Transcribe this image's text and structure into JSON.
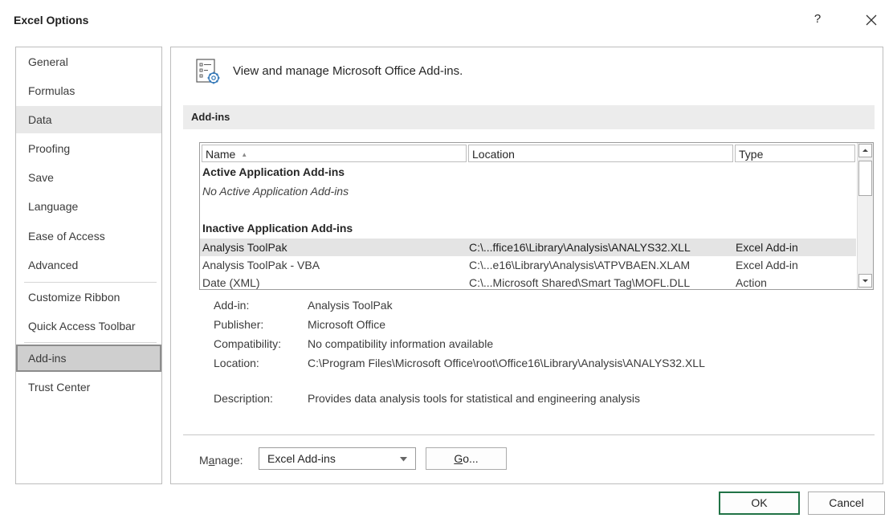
{
  "window": {
    "title": "Excel Options",
    "help_label": "?",
    "close_icon": "close-icon"
  },
  "sidebar": {
    "items": [
      {
        "label": "General"
      },
      {
        "label": "Formulas"
      },
      {
        "label": "Data"
      },
      {
        "label": "Proofing"
      },
      {
        "label": "Save"
      },
      {
        "label": "Language"
      },
      {
        "label": "Ease of Access"
      },
      {
        "label": "Advanced"
      },
      {
        "label": "Customize Ribbon"
      },
      {
        "label": "Quick Access Toolbar"
      },
      {
        "label": "Add-ins"
      },
      {
        "label": "Trust Center"
      }
    ],
    "selected": "Add-ins",
    "hovered": "Data"
  },
  "header": {
    "icon": "addins-gear-icon",
    "text": "View and manage Microsoft Office Add-ins."
  },
  "section": {
    "title": "Add-ins"
  },
  "addins_list": {
    "columns": [
      "Name",
      "Location",
      "Type"
    ],
    "sort_indicator": "▲",
    "groups": [
      {
        "header": "Active Application Add-ins",
        "empty_text": "No Active Application Add-ins"
      },
      {
        "header": "Inactive Application Add-ins"
      }
    ],
    "rows": [
      {
        "name": "Analysis ToolPak",
        "location": "C:\\...ffice16\\Library\\Analysis\\ANALYS32.XLL",
        "type": "Excel Add-in"
      },
      {
        "name": "Analysis ToolPak - VBA",
        "location": "C:\\...e16\\Library\\Analysis\\ATPVBAEN.XLAM",
        "type": "Excel Add-in"
      },
      {
        "name": "Date (XML)",
        "location": "C:\\...Microsoft Shared\\Smart Tag\\MOFL.DLL",
        "type": "Action"
      }
    ]
  },
  "details": {
    "addin_label": "Add-in:",
    "addin_value": "Analysis ToolPak",
    "publisher_label": "Publisher:",
    "publisher_value": "Microsoft Office",
    "compat_label": "Compatibility:",
    "compat_value": "No compatibility information available",
    "location_label": "Location:",
    "location_value": "C:\\Program Files\\Microsoft Office\\root\\Office16\\Library\\Analysis\\ANALYS32.XLL",
    "description_label": "Description:",
    "description_value": "Provides data analysis tools for statistical and engineering analysis"
  },
  "manage": {
    "label_prefix": "M",
    "label_accel": "a",
    "label_suffix": "nage:",
    "selected": "Excel Add-ins",
    "go_accel": "G",
    "go_suffix": "o..."
  },
  "footer": {
    "ok_label": "OK",
    "cancel_label": "Cancel"
  },
  "colors": {
    "ok_border": "#217346",
    "selected_nav": "#cfcfcf",
    "selected_row": "#e4e4e4"
  }
}
